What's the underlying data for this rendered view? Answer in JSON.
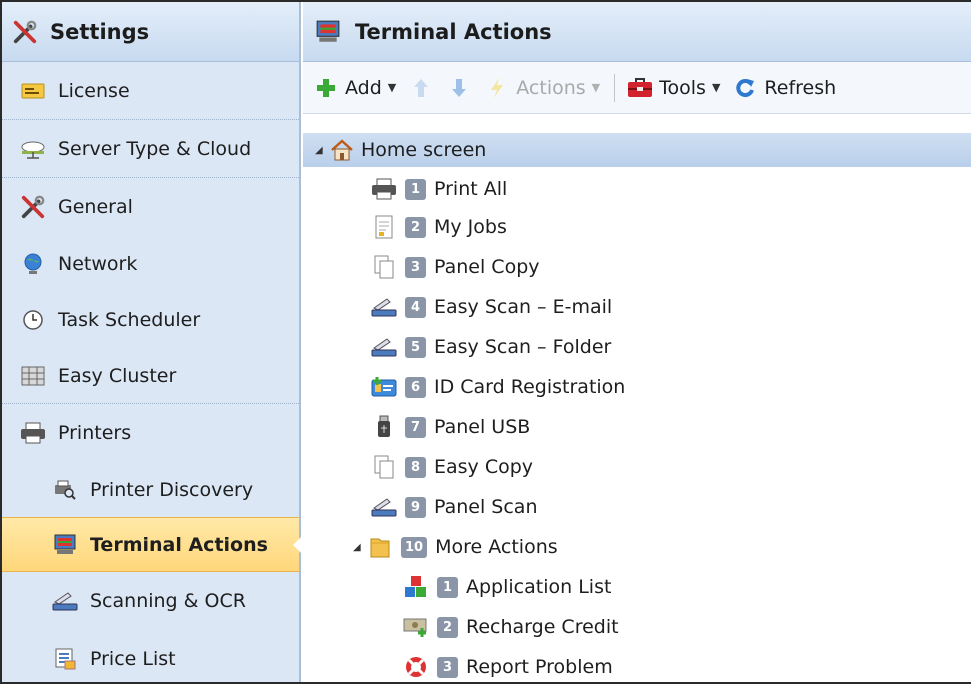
{
  "sidebar": {
    "title": "Settings",
    "items": [
      {
        "label": "License"
      },
      {
        "label": "Server Type & Cloud"
      },
      {
        "label": "General"
      },
      {
        "label": "Network"
      },
      {
        "label": "Task Scheduler"
      },
      {
        "label": "Easy Cluster"
      },
      {
        "label": "Printers"
      },
      {
        "label": "Printer Discovery"
      },
      {
        "label": "Terminal Actions"
      },
      {
        "label": "Scanning & OCR"
      },
      {
        "label": "Price List"
      }
    ]
  },
  "main": {
    "title": "Terminal Actions",
    "toolbar": {
      "add": "Add",
      "actions": "Actions",
      "tools": "Tools",
      "refresh": "Refresh"
    },
    "tree": {
      "root": "Home screen",
      "items": [
        {
          "num": "1",
          "label": "Print All",
          "icon": "printer-icon"
        },
        {
          "num": "2",
          "label": "My Jobs",
          "icon": "document-icon"
        },
        {
          "num": "3",
          "label": "Panel Copy",
          "icon": "copy-icon"
        },
        {
          "num": "4",
          "label": "Easy Scan – E-mail",
          "icon": "scanner-icon"
        },
        {
          "num": "5",
          "label": "Easy Scan – Folder",
          "icon": "scanner-icon"
        },
        {
          "num": "6",
          "label": "ID Card Registration",
          "icon": "id-card-icon"
        },
        {
          "num": "7",
          "label": "Panel USB",
          "icon": "usb-icon"
        },
        {
          "num": "8",
          "label": "Easy Copy",
          "icon": "copy-icon"
        },
        {
          "num": "9",
          "label": "Panel Scan",
          "icon": "scanner-icon"
        },
        {
          "num": "10",
          "label": "More Actions",
          "icon": "folder-icon"
        }
      ],
      "sub_items": [
        {
          "num": "1",
          "label": "Application List",
          "icon": "app-blocks-icon"
        },
        {
          "num": "2",
          "label": "Recharge Credit",
          "icon": "credit-icon"
        },
        {
          "num": "3",
          "label": "Report Problem",
          "icon": "lifebuoy-icon"
        }
      ]
    }
  },
  "colors": {
    "active_bg": "#ffd77a",
    "header_bg": "#c7daf0",
    "sidebar_bg": "#dbe7f5",
    "badge": "#8a96a8"
  }
}
